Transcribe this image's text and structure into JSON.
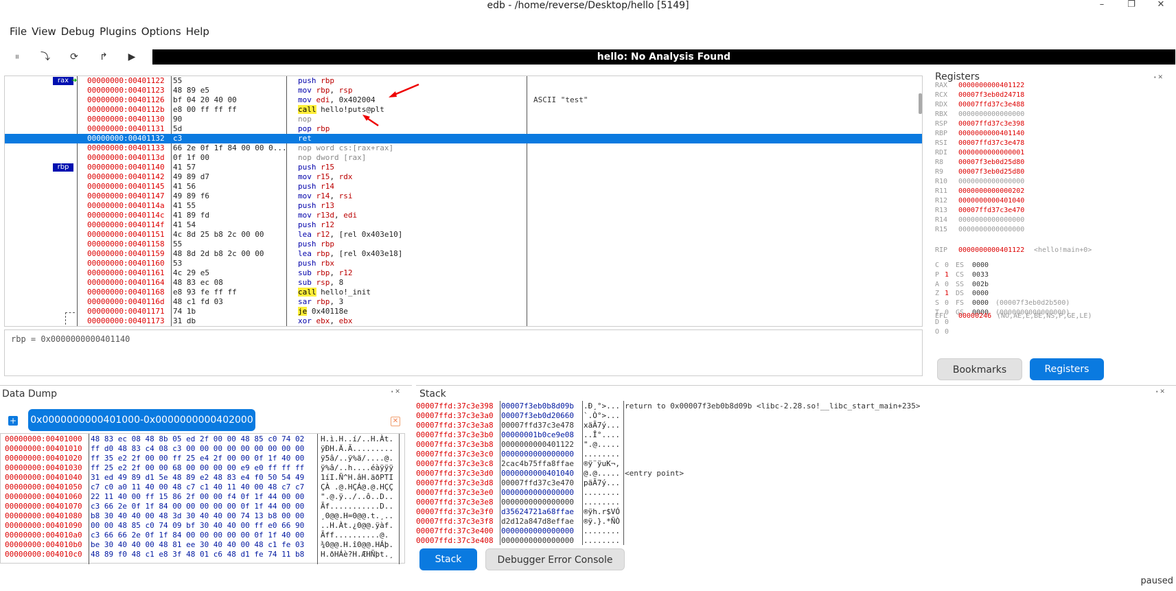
{
  "window": {
    "title": "edb - /home/reverse/Desktop/hello [5149]",
    "controls": [
      "–",
      "❐",
      "✕"
    ]
  },
  "menu": [
    "File",
    "View",
    "Debug",
    "Plugins",
    "Options",
    "Help"
  ],
  "toolbar": {
    "banner": "hello: No Analysis Found",
    "icons": [
      "pause-icon",
      "step-into-icon",
      "step-over-icon",
      "step-out-icon",
      "run-icon"
    ],
    "icon_glyphs": [
      "⏸",
      "⤵",
      "⟳",
      "↱",
      "▶"
    ]
  },
  "disasm": {
    "labels": [
      {
        "row": 0,
        "text": "rax"
      },
      {
        "row": 9,
        "text": "rbp"
      }
    ],
    "rows": [
      {
        "addr": "00000000:00401122",
        "bytes": "55",
        "ins": [
          [
            "opb",
            "push"
          ],
          [
            "t",
            " "
          ],
          [
            "op",
            "rbp"
          ]
        ],
        "cmt": ""
      },
      {
        "addr": "00000000:00401123",
        "bytes": "48 89 e5",
        "ins": [
          [
            "opb",
            "mov"
          ],
          [
            "t",
            " "
          ],
          [
            "op",
            "rbp"
          ],
          [
            "t",
            ", "
          ],
          [
            "op",
            "rsp"
          ]
        ],
        "cmt": ""
      },
      {
        "addr": "00000000:00401126",
        "bytes": "bf 04 20 40 00",
        "ins": [
          [
            "opb",
            "mov"
          ],
          [
            "t",
            " "
          ],
          [
            "op",
            "edi"
          ],
          [
            "t",
            ", 0x402004"
          ]
        ],
        "cmt": "ASCII \"test\""
      },
      {
        "addr": "00000000:0040112b",
        "bytes": "e8 00 ff ff ff",
        "ins": [
          [
            "kw",
            "call"
          ],
          [
            "t",
            " hello!puts@plt"
          ]
        ],
        "cmt": ""
      },
      {
        "addr": "00000000:00401130",
        "bytes": "90",
        "ins": [
          [
            "gray",
            "nop"
          ]
        ],
        "cmt": ""
      },
      {
        "addr": "00000000:00401131",
        "bytes": "5d",
        "ins": [
          [
            "opb",
            "pop"
          ],
          [
            "t",
            " "
          ],
          [
            "op",
            "rbp"
          ]
        ],
        "cmt": ""
      },
      {
        "addr": "00000000:00401132",
        "bytes": "c3",
        "ins": [
          [
            "t",
            "ret"
          ]
        ],
        "cmt": "",
        "sel": true
      },
      {
        "addr": "00000000:00401133",
        "bytes": "66 2e 0f 1f 84 00 00 0...",
        "ins": [
          [
            "gray",
            "nop word cs:[rax+rax]"
          ]
        ],
        "cmt": ""
      },
      {
        "addr": "00000000:0040113d",
        "bytes": "0f 1f 00",
        "ins": [
          [
            "gray",
            "nop dword [rax]"
          ]
        ],
        "cmt": ""
      },
      {
        "addr": "00000000:00401140",
        "bytes": "41 57",
        "ins": [
          [
            "opb",
            "push"
          ],
          [
            "t",
            " "
          ],
          [
            "op",
            "r15"
          ]
        ],
        "cmt": ""
      },
      {
        "addr": "00000000:00401142",
        "bytes": "49 89 d7",
        "ins": [
          [
            "opb",
            "mov"
          ],
          [
            "t",
            " "
          ],
          [
            "op",
            "r15"
          ],
          [
            "t",
            ", "
          ],
          [
            "op",
            "rdx"
          ]
        ],
        "cmt": ""
      },
      {
        "addr": "00000000:00401145",
        "bytes": "41 56",
        "ins": [
          [
            "opb",
            "push"
          ],
          [
            "t",
            " "
          ],
          [
            "op",
            "r14"
          ]
        ],
        "cmt": ""
      },
      {
        "addr": "00000000:00401147",
        "bytes": "49 89 f6",
        "ins": [
          [
            "opb",
            "mov"
          ],
          [
            "t",
            " "
          ],
          [
            "op",
            "r14"
          ],
          [
            "t",
            ", "
          ],
          [
            "op",
            "rsi"
          ]
        ],
        "cmt": ""
      },
      {
        "addr": "00000000:0040114a",
        "bytes": "41 55",
        "ins": [
          [
            "opb",
            "push"
          ],
          [
            "t",
            " "
          ],
          [
            "op",
            "r13"
          ]
        ],
        "cmt": ""
      },
      {
        "addr": "00000000:0040114c",
        "bytes": "41 89 fd",
        "ins": [
          [
            "opb",
            "mov"
          ],
          [
            "t",
            " "
          ],
          [
            "op",
            "r13d"
          ],
          [
            "t",
            ", "
          ],
          [
            "op",
            "edi"
          ]
        ],
        "cmt": ""
      },
      {
        "addr": "00000000:0040114f",
        "bytes": "41 54",
        "ins": [
          [
            "opb",
            "push"
          ],
          [
            "t",
            " "
          ],
          [
            "op",
            "r12"
          ]
        ],
        "cmt": ""
      },
      {
        "addr": "00000000:00401151",
        "bytes": "4c 8d 25 b8 2c 00 00",
        "ins": [
          [
            "opb",
            "lea"
          ],
          [
            "t",
            " "
          ],
          [
            "op",
            "r12"
          ],
          [
            "t",
            ", [rel 0x403e10]"
          ]
        ],
        "cmt": ""
      },
      {
        "addr": "00000000:00401158",
        "bytes": "55",
        "ins": [
          [
            "opb",
            "push"
          ],
          [
            "t",
            " "
          ],
          [
            "op",
            "rbp"
          ]
        ],
        "cmt": ""
      },
      {
        "addr": "00000000:00401159",
        "bytes": "48 8d 2d b8 2c 00 00",
        "ins": [
          [
            "opb",
            "lea"
          ],
          [
            "t",
            " "
          ],
          [
            "op",
            "rbp"
          ],
          [
            "t",
            ", [rel 0x403e18]"
          ]
        ],
        "cmt": ""
      },
      {
        "addr": "00000000:00401160",
        "bytes": "53",
        "ins": [
          [
            "opb",
            "push"
          ],
          [
            "t",
            " "
          ],
          [
            "op",
            "rbx"
          ]
        ],
        "cmt": ""
      },
      {
        "addr": "00000000:00401161",
        "bytes": "4c 29 e5",
        "ins": [
          [
            "opb",
            "sub"
          ],
          [
            "t",
            " "
          ],
          [
            "op",
            "rbp"
          ],
          [
            "t",
            ", "
          ],
          [
            "op",
            "r12"
          ]
        ],
        "cmt": ""
      },
      {
        "addr": "00000000:00401164",
        "bytes": "48 83 ec 08",
        "ins": [
          [
            "opb",
            "sub"
          ],
          [
            "t",
            " "
          ],
          [
            "op",
            "rsp"
          ],
          [
            "t",
            ", 8"
          ]
        ],
        "cmt": ""
      },
      {
        "addr": "00000000:00401168",
        "bytes": "e8 93 fe ff ff",
        "ins": [
          [
            "kw",
            "call"
          ],
          [
            "t",
            " hello!_init"
          ]
        ],
        "cmt": ""
      },
      {
        "addr": "00000000:0040116d",
        "bytes": "48 c1 fd 03",
        "ins": [
          [
            "opb",
            "sar"
          ],
          [
            "t",
            " "
          ],
          [
            "op",
            "rbp"
          ],
          [
            "t",
            ", 3"
          ]
        ],
        "cmt": ""
      },
      {
        "addr": "00000000:00401171",
        "bytes": "74 1b",
        "ins": [
          [
            "kw",
            "je"
          ],
          [
            "t",
            " 0x40118e"
          ]
        ],
        "cmt": ""
      },
      {
        "addr": "00000000:00401173",
        "bytes": "31 db",
        "ins": [
          [
            "opb",
            "xor"
          ],
          [
            "t",
            " "
          ],
          [
            "op",
            "ebx"
          ],
          [
            "t",
            ", "
          ],
          [
            "op",
            "ebx"
          ]
        ],
        "cmt": ""
      }
    ]
  },
  "expression": "rbp = 0x0000000000401140",
  "registers": {
    "title": "Registers",
    "gp": [
      [
        "RAX",
        "0000000000401122",
        true
      ],
      [
        "RCX",
        "00007f3eb0d24718",
        true
      ],
      [
        "RDX",
        "00007ffd37c3e488",
        true
      ],
      [
        "RBX",
        "0000000000000000",
        false
      ],
      [
        "RSP",
        "00007ffd37c3e398",
        true
      ],
      [
        "RBP",
        "0000000000401140",
        true
      ],
      [
        "RSI",
        "00007ffd37c3e478",
        true
      ],
      [
        "RDI",
        "0000000000000001",
        true
      ],
      [
        "R8",
        "00007f3eb0d25d80",
        true
      ],
      [
        "R9",
        "00007f3eb0d25d80",
        true
      ],
      [
        "R10",
        "0000000000000000",
        false
      ],
      [
        "R11",
        "0000000000000202",
        true
      ],
      [
        "R12",
        "0000000000401040",
        true
      ],
      [
        "R13",
        "00007ffd37c3e470",
        true
      ],
      [
        "R14",
        "0000000000000000",
        false
      ],
      [
        "R15",
        "0000000000000000",
        false
      ]
    ],
    "rip": {
      "name": "RIP",
      "value": "0000000000401122",
      "sym": "<hello!main+0>"
    },
    "flags": [
      [
        "C",
        "0",
        "ES",
        "0000",
        ""
      ],
      [
        "P",
        "1",
        "CS",
        "0033",
        ""
      ],
      [
        "A",
        "0",
        "SS",
        "002b",
        ""
      ],
      [
        "Z",
        "1",
        "DS",
        "0000",
        ""
      ],
      [
        "S",
        "0",
        "FS",
        "0000",
        "(00007f3eb0d2b500)"
      ],
      [
        "T",
        "0",
        "GS",
        "0000",
        "(0000000000000000)"
      ],
      [
        "D",
        "0",
        "",
        "",
        " "
      ],
      [
        "O",
        "0",
        "",
        "",
        ""
      ]
    ],
    "efl": {
      "name": "EFL",
      "value": "00000246",
      "desc": "(NO,AE,E,BE,NS,P,GE,LE)"
    }
  },
  "right_tabs": {
    "bookmarks": "Bookmarks",
    "registers": "Registers"
  },
  "dump": {
    "title": "Data Dump",
    "tab": "0x0000000000401000-0x0000000000402000",
    "rows": [
      [
        "00000000:00401000",
        "48 83 ec 08 48 8b 05 ed 2f 00 00 48 85 c0 74 02",
        "H.ì.H..í/..H.Àt."
      ],
      [
        "00000000:00401010",
        "ff d0 48 83 c4 08 c3 00 00 00 00 00 00 00 00 00",
        "ÿÐH.Ä.Ã........."
      ],
      [
        "00000000:00401020",
        "ff 35 e2 2f 00 00 ff 25 e4 2f 00 00 0f 1f 40 00",
        "ÿ5â/..ÿ%ä/....@."
      ],
      [
        "00000000:00401030",
        "ff 25 e2 2f 00 00 68 00 00 00 00 e9 e0 ff ff ff",
        "ÿ%â/..h....éàÿÿÿ"
      ],
      [
        "00000000:00401040",
        "31 ed 49 89 d1 5e 48 89 e2 48 83 e4 f0 50 54 49",
        "1íI.Ñ^H.âH.äðPTI"
      ],
      [
        "00000000:00401050",
        "c7 c0 a0 11 40 00 48 c7 c1 40 11 40 00 48 c7 c7",
        "ÇÀ .@.HÇÁ@.@.HÇÇ"
      ],
      [
        "00000000:00401060",
        "22 11 40 00 ff 15 86 2f 00 00 f4 0f 1f 44 00 00",
        "\".@.ÿ../..ô..D.."
      ],
      [
        "00000000:00401070",
        "c3 66 2e 0f 1f 84 00 00 00 00 00 0f 1f 44 00 00",
        "Ãf...........D.."
      ],
      [
        "00000000:00401080",
        "b8 30 40 40 00 48 3d 30 40 40 00 74 13 b8 00 00",
        "¸0@@.H=0@@.t.¸.."
      ],
      [
        "00000000:00401090",
        "00 00 48 85 c0 74 09 bf 30 40 40 00 ff e0 66 90",
        "..H.Àt.¿0@@.ÿàf."
      ],
      [
        "00000000:004010a0",
        "c3 66 66 2e 0f 1f 84 00 00 00 00 00 0f 1f 40 00",
        "Ãff..........@."
      ],
      [
        "00000000:004010b0",
        "be 30 40 40 00 48 81 ee 30 40 40 00 48 c1 fe 03",
        "¾0@@.H.î0@@.HÁþ."
      ],
      [
        "00000000:004010c0",
        "48 89 f0 48 c1 e8 3f 48 01 c6 48 d1 fe 74 11 b8",
        "H.ðHÁè?H.ÆHÑþt.¸"
      ]
    ]
  },
  "stack": {
    "title": "Stack",
    "rows": [
      [
        "00007ffd:37c3e398",
        "00007f3eb0b8d09b",
        ".Ð¸°>...",
        "return to 0x00007f3eb0b8d09b <libc-2.28.so!__libc_start_main+235>"
      ],
      [
        "00007ffd:37c3e3a0",
        "00007f3eb0d20660",
        "`.Ò°>...",
        ""
      ],
      [
        "00007ffd:37c3e3a8",
        "00007ffd37c3e478",
        "xäÃ7ý...",
        ""
      ],
      [
        "00007ffd:37c3e3b0",
        "00000001b0ce9e08",
        "..Î°....",
        ""
      ],
      [
        "00007ffd:37c3e3b8",
        "0000000000401122",
        "\".@.....",
        ""
      ],
      [
        "00007ffd:37c3e3c0",
        "0000000000000000",
        "........",
        ""
      ],
      [
        "00007ffd:37c3e3c8",
        "2cac4b75ffa8ffae",
        "®ÿ¨ÿuK¬,",
        ""
      ],
      [
        "00007ffd:37c3e3d0",
        "0000000000401040",
        "@.@.....",
        "<entry point>"
      ],
      [
        "00007ffd:37c3e3d8",
        "00007ffd37c3e470",
        "päÃ7ý...",
        ""
      ],
      [
        "00007ffd:37c3e3e0",
        "0000000000000000",
        "........",
        ""
      ],
      [
        "00007ffd:37c3e3e8",
        "0000000000000000",
        "........",
        ""
      ],
      [
        "00007ffd:37c3e3f0",
        "d35624721a68ffae",
        "®ÿh.r$VÓ",
        ""
      ],
      [
        "00007ffd:37c3e3f8",
        "d2d12a847d8effae",
        "®ÿ.}.*ÑÒ",
        ""
      ],
      [
        "00007ffd:37c3e400",
        "0000000000000000",
        "........",
        ""
      ],
      [
        "00007ffd:37c3e408",
        "0000000000000000",
        "........",
        ""
      ]
    ]
  },
  "bottom_tabs": {
    "stack": "Stack",
    "console": "Debugger Error Console"
  },
  "status": "paused"
}
